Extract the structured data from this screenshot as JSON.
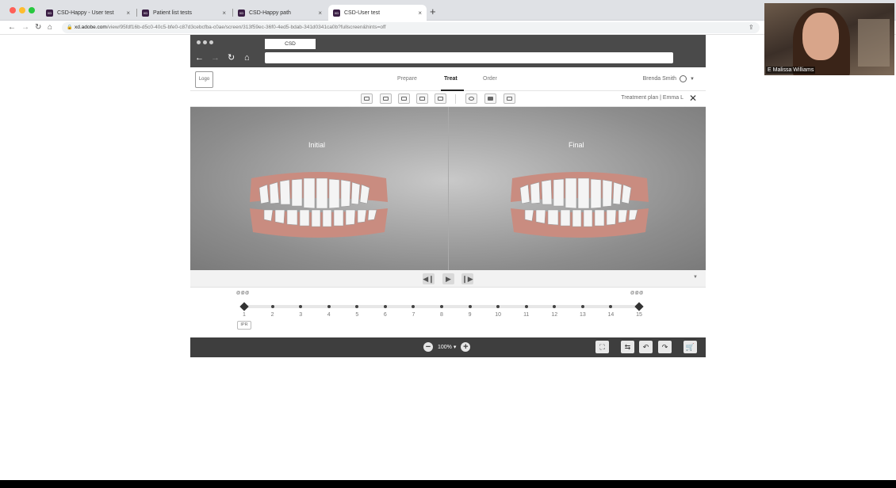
{
  "browser": {
    "tabs": [
      {
        "label": "CSD-Happy - User test",
        "favicon": "XD",
        "active": false
      },
      {
        "label": "Patient list tests",
        "favicon": "XD",
        "active": false
      },
      {
        "label": "CSD-Happy path",
        "favicon": "XD",
        "active": false
      },
      {
        "label": "CSD-User test",
        "favicon": "XD",
        "active": true
      }
    ],
    "new_tab_label": "+",
    "tab_close": "×",
    "url_domain": "xd.adobe.com",
    "url_path": "/view/95fdf16b-d5c0-40c5-bfe0-c87d3cebcfba-c0ae/screen/313f59ec-36f0-4ed5-bdab-341d0341ca0b?fullscreen&hints=off"
  },
  "webcam": {
    "name": "E Malissa Williams"
  },
  "prototype": {
    "browser_tab": "CSD",
    "logo": "Logo",
    "nav": {
      "prepare": "Prepare",
      "treat": "Treat",
      "order": "Order"
    },
    "user": "Brenda Smith",
    "plan_label": "Treatment plan | Emma L",
    "viewer": {
      "initial_label": "Initial",
      "final_label": "Final"
    },
    "timeline": {
      "stages": [
        "1",
        "2",
        "3",
        "4",
        "5",
        "6",
        "7",
        "8",
        "9",
        "10",
        "11",
        "12",
        "13",
        "14",
        "15"
      ],
      "current_stage": 1,
      "start_attachments": "@@@",
      "end_attachments": "@@@",
      "ipr_label": "IPR"
    },
    "zoom": "100% ▾"
  },
  "colors": {
    "prototype_chrome": "#4a4a4a",
    "bottom_bar": "#3e3e3e",
    "viewer_bg": "#8d8d8d",
    "gum": "#c98c80"
  }
}
